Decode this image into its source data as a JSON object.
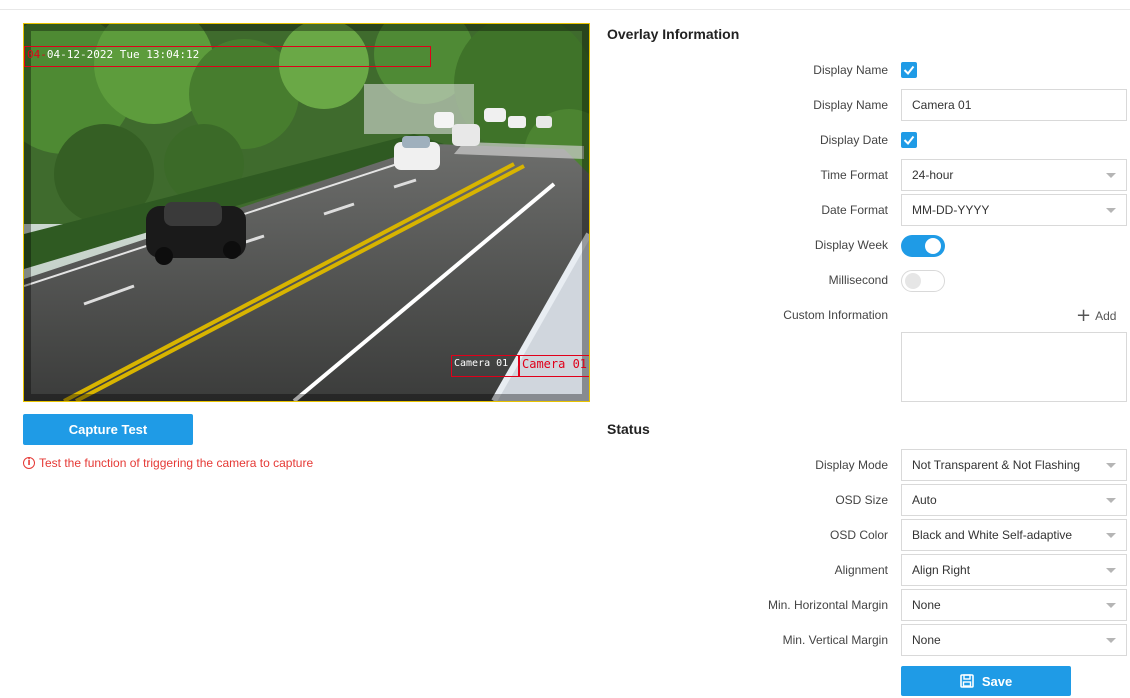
{
  "preview": {
    "osd_date_red": "04-",
    "osd_date_white": "04-12-2022 Tue 13:04:12",
    "osd_cam_white": "Camera 01",
    "osd_cam_red": "Camera 01"
  },
  "capture": {
    "button_label": "Capture Test",
    "hint": "Test the function of triggering the camera to capture"
  },
  "overlay": {
    "title": "Overlay Information",
    "display_name_check_label": "Display Name",
    "display_name_checked": true,
    "display_name_label": "Display Name",
    "display_name_value": "Camera 01",
    "display_date_label": "Display Date",
    "display_date_checked": true,
    "time_format_label": "Time Format",
    "time_format_value": "24-hour",
    "date_format_label": "Date Format",
    "date_format_value": "MM-DD-YYYY",
    "display_week_label": "Display Week",
    "display_week_on": true,
    "millisecond_label": "Millisecond",
    "millisecond_on": false,
    "custom_info_label": "Custom Information",
    "add_label": "Add"
  },
  "status": {
    "title": "Status",
    "display_mode_label": "Display Mode",
    "display_mode_value": "Not Transparent & Not Flashing",
    "osd_size_label": "OSD Size",
    "osd_size_value": "Auto",
    "osd_color_label": "OSD Color",
    "osd_color_value": "Black and White Self-adaptive",
    "alignment_label": "Alignment",
    "alignment_value": "Align Right",
    "min_h_margin_label": "Min. Horizontal Margin",
    "min_h_margin_value": "None",
    "min_v_margin_label": "Min. Vertical Margin",
    "min_v_margin_value": "None"
  },
  "save_label": "Save",
  "colors": {
    "accent": "#1f9be6",
    "osd_red": "#e0001a",
    "hint_red": "#e53935"
  }
}
